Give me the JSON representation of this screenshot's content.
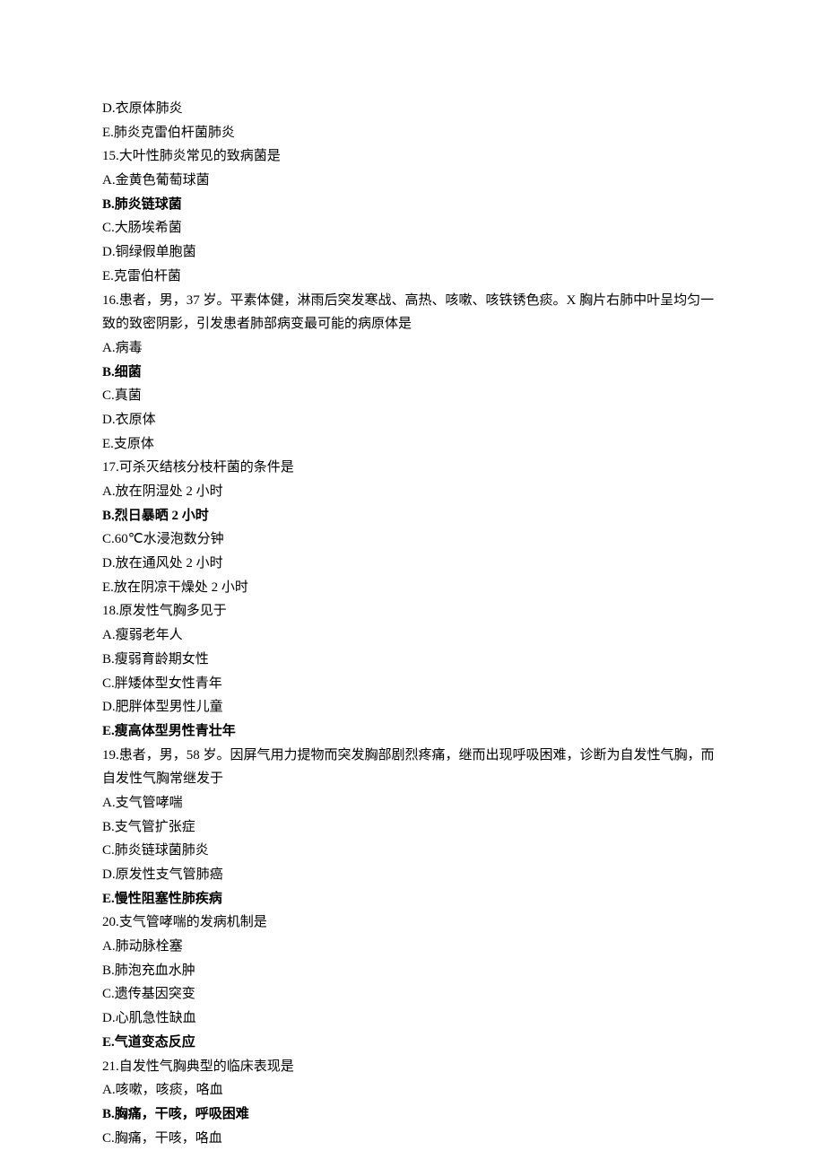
{
  "lines": [
    {
      "text": "D.衣原体肺炎",
      "bold": false
    },
    {
      "text": "E.肺炎克雷伯杆菌肺炎",
      "bold": false
    },
    {
      "text": "15.大叶性肺炎常见的致病菌是",
      "bold": false
    },
    {
      "text": "A.金黄色葡萄球菌",
      "bold": false
    },
    {
      "text": "B.肺炎链球菌",
      "bold": true
    },
    {
      "text": "C.大肠埃希菌",
      "bold": false
    },
    {
      "text": "D.铜绿假单胞菌",
      "bold": false
    },
    {
      "text": "E.克雷伯杆菌",
      "bold": false
    },
    {
      "text": "16.患者，男，37 岁。平素体健，淋雨后突发寒战、高热、咳嗽、咳铁锈色痰。X 胸片右肺中叶呈均匀一致的致密阴影，引发患者肺部病变最可能的病原体是",
      "bold": false
    },
    {
      "text": "A.病毒",
      "bold": false
    },
    {
      "text": "B.细菌",
      "bold": true
    },
    {
      "text": "C.真菌",
      "bold": false
    },
    {
      "text": "D.衣原体",
      "bold": false
    },
    {
      "text": "E.支原体",
      "bold": false
    },
    {
      "text": "17.可杀灭结核分枝杆菌的条件是",
      "bold": false
    },
    {
      "text": "A.放在阴湿处 2 小时",
      "bold": false
    },
    {
      "text": "B.烈日暴晒 2 小时",
      "bold": true
    },
    {
      "text": "C.60℃水浸泡数分钟",
      "bold": false
    },
    {
      "text": "D.放在通风处 2 小时",
      "bold": false
    },
    {
      "text": "E.放在阴凉干燥处 2 小时",
      "bold": false
    },
    {
      "text": "18.原发性气胸多见于",
      "bold": false
    },
    {
      "text": "A.瘦弱老年人",
      "bold": false
    },
    {
      "text": "B.瘦弱育龄期女性",
      "bold": false
    },
    {
      "text": "C.胖矮体型女性青年",
      "bold": false
    },
    {
      "text": "D.肥胖体型男性儿童",
      "bold": false
    },
    {
      "text": "E.瘦高体型男性青壮年",
      "bold": true
    },
    {
      "text": "19.患者，男，58 岁。因屏气用力提物而突发胸部剧烈疼痛，继而出现呼吸困难，诊断为自发性气胸，而自发性气胸常继发于",
      "bold": false
    },
    {
      "text": "A.支气管哮喘",
      "bold": false
    },
    {
      "text": "B.支气管扩张症",
      "bold": false
    },
    {
      "text": "C.肺炎链球菌肺炎",
      "bold": false
    },
    {
      "text": "D.原发性支气管肺癌",
      "bold": false
    },
    {
      "text": "E.慢性阻塞性肺疾病",
      "bold": true
    },
    {
      "text": "20.支气管哮喘的发病机制是",
      "bold": false
    },
    {
      "text": "A.肺动脉栓塞",
      "bold": false
    },
    {
      "text": "B.肺泡充血水肿",
      "bold": false
    },
    {
      "text": "C.遗传基因突变",
      "bold": false
    },
    {
      "text": "D.心肌急性缺血",
      "bold": false
    },
    {
      "text": "E.气道变态反应",
      "bold": true
    },
    {
      "text": "21.自发性气胸典型的临床表现是",
      "bold": false
    },
    {
      "text": "A.咳嗽，咳痰，咯血",
      "bold": false
    },
    {
      "text": "B.胸痛，干咳，呼吸困难",
      "bold": true
    },
    {
      "text": "C.胸痛，干咳，咯血",
      "bold": false
    }
  ]
}
